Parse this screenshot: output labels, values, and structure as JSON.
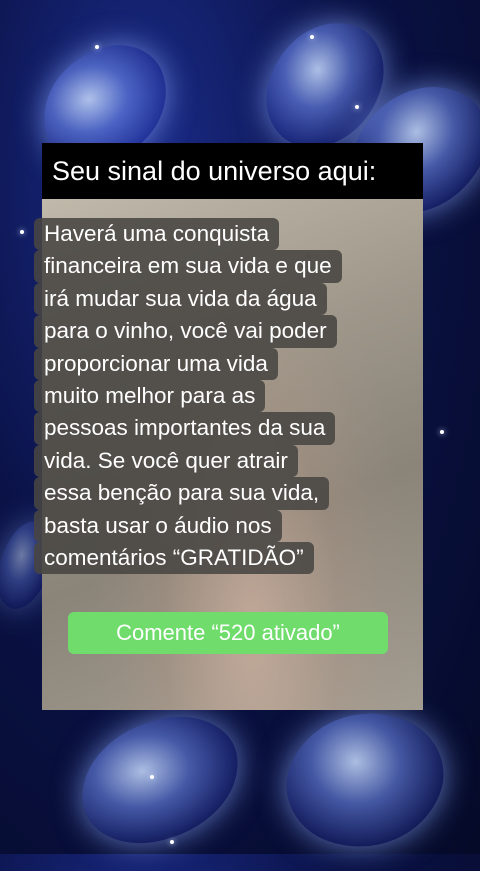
{
  "header": {
    "title": "Seu sinal do universo aqui:"
  },
  "message": {
    "lines": [
      "Haverá uma conquista",
      "financeira em sua vida e que",
      "irá mudar sua vida da água",
      "para o vinho, você vai poder",
      "proporcionar uma vida",
      "muito melhor para as",
      "pessoas importantes da sua",
      "vida. Se você quer atrair",
      "essa benção para sua vida,",
      "basta usar o áudio nos",
      "comentários “GRATIDÃO”"
    ]
  },
  "cta": {
    "label": "Comente “520 ativado”",
    "color": "#6fdc6c"
  },
  "colors": {
    "background": "#0a1246",
    "header_bg": "#000000",
    "text_box": "#484642"
  }
}
